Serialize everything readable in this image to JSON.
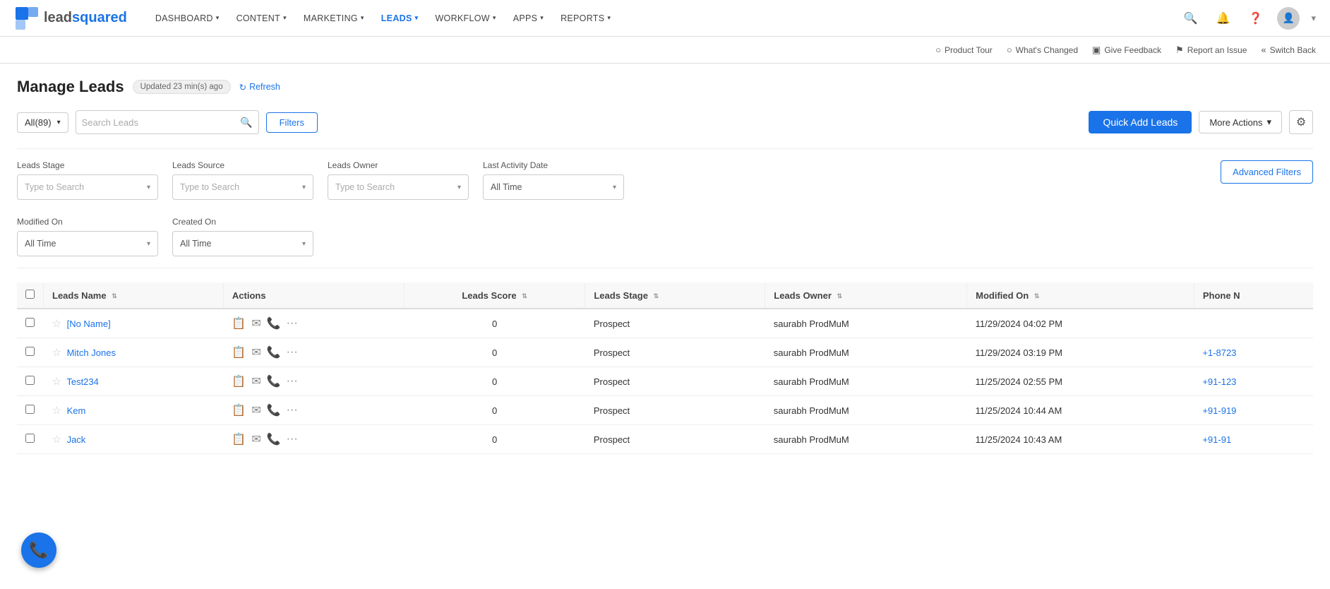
{
  "brand": {
    "name_part1": "lead",
    "name_part2": "squared"
  },
  "top_nav": {
    "items": [
      {
        "label": "DASHBOARD",
        "has_caret": true
      },
      {
        "label": "CONTENT",
        "has_caret": true
      },
      {
        "label": "MARKETING",
        "has_caret": true
      },
      {
        "label": "LEADS",
        "has_caret": true
      },
      {
        "label": "WORKFLOW",
        "has_caret": true
      },
      {
        "label": "APPS",
        "has_caret": true
      },
      {
        "label": "REPORTS",
        "has_caret": true
      }
    ]
  },
  "sub_nav": {
    "items": [
      {
        "label": "Product Tour",
        "icon": "○"
      },
      {
        "label": "What's Changed",
        "icon": "○"
      },
      {
        "label": "Give Feedback",
        "icon": "▣"
      },
      {
        "label": "Report an Issue",
        "icon": "⚑"
      },
      {
        "label": "Switch Back",
        "icon": "«"
      }
    ]
  },
  "page": {
    "title": "Manage Leads",
    "updated_text": "Updated 23 min(s) ago",
    "refresh_label": "Refresh"
  },
  "toolbar": {
    "all_leads_label": "All(89)",
    "search_placeholder": "Search Leads",
    "filters_label": "Filters",
    "quick_add_label": "Quick Add Leads",
    "more_actions_label": "More Actions"
  },
  "filters": {
    "leads_stage_label": "Leads Stage",
    "leads_stage_placeholder": "Type to Search",
    "leads_source_label": "Leads Source",
    "leads_source_placeholder": "Type to Search",
    "leads_owner_label": "Leads Owner",
    "leads_owner_placeholder": "Type to Search",
    "last_activity_label": "Last Activity Date",
    "last_activity_value": "All Time",
    "modified_on_label": "Modified On",
    "modified_on_value": "All Time",
    "created_on_label": "Created On",
    "created_on_value": "All Time",
    "advanced_label": "Advanced Filters"
  },
  "table": {
    "columns": [
      {
        "label": "Leads Name",
        "sortable": true
      },
      {
        "label": "Actions",
        "sortable": false
      },
      {
        "label": "Leads Score",
        "sortable": true
      },
      {
        "label": "Leads Stage",
        "sortable": true
      },
      {
        "label": "Leads Owner",
        "sortable": true
      },
      {
        "label": "Modified On",
        "sortable": true
      },
      {
        "label": "Phone N",
        "sortable": false
      }
    ],
    "rows": [
      {
        "name": "[No Name]",
        "name_is_link": true,
        "score": "0",
        "stage": "Prospect",
        "owner": "saurabh ProdMuM",
        "modified": "11/29/2024 04:02 PM",
        "phone": ""
      },
      {
        "name": "Mitch Jones",
        "name_is_link": true,
        "score": "0",
        "stage": "Prospect",
        "owner": "saurabh ProdMuM",
        "modified": "11/29/2024 03:19 PM",
        "phone": "+1-8723"
      },
      {
        "name": "Test234",
        "name_is_link": true,
        "score": "0",
        "stage": "Prospect",
        "owner": "saurabh ProdMuM",
        "modified": "11/25/2024 02:55 PM",
        "phone": "+91-123"
      },
      {
        "name": "Kem",
        "name_is_link": true,
        "score": "0",
        "stage": "Prospect",
        "owner": "saurabh ProdMuM",
        "modified": "11/25/2024 10:44 AM",
        "phone": "+91-919"
      },
      {
        "name": "Jack",
        "name_is_link": true,
        "score": "0",
        "stage": "Prospect",
        "owner": "saurabh ProdMuM",
        "modified": "11/25/2024 10:43 AM",
        "phone": "+91-91"
      }
    ]
  },
  "colors": {
    "primary": "#1a73e8",
    "text_link": "#1a73e8",
    "border": "#ddd",
    "bg_light": "#f8f8f8"
  }
}
